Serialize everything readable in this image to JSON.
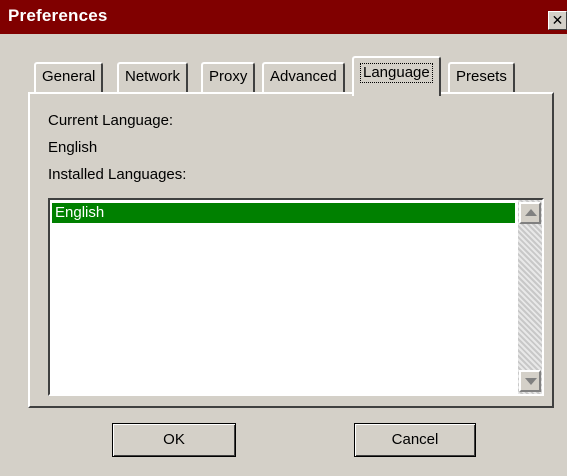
{
  "window": {
    "title": "Preferences",
    "close_glyph": "✕"
  },
  "tabs": [
    {
      "label": "General"
    },
    {
      "label": "Network"
    },
    {
      "label": "Proxy"
    },
    {
      "label": "Advanced"
    },
    {
      "label": "Language",
      "active": true
    },
    {
      "label": "Presets"
    }
  ],
  "panel": {
    "current_language_label": "Current Language:",
    "current_language_value": "English",
    "installed_label": "Installed Languages:",
    "installed_languages": [
      "English"
    ],
    "selected_color": "#008000"
  },
  "buttons": {
    "ok": "OK",
    "cancel": "Cancel"
  },
  "icons": {
    "close": "close-icon",
    "scroll_up": "scroll-up-arrow-icon",
    "scroll_down": "scroll-down-arrow-icon"
  }
}
